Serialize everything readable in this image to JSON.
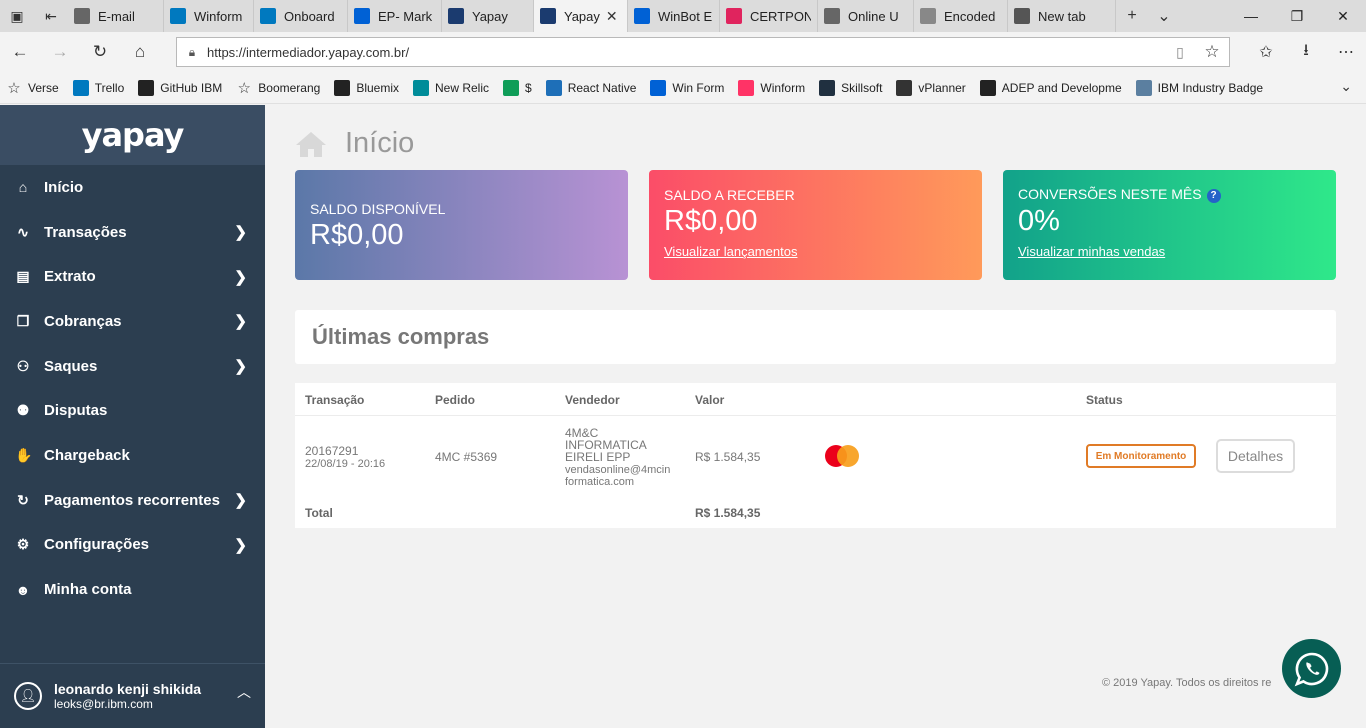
{
  "browser": {
    "tabs": [
      {
        "title": "E-mail",
        "icon": "page-icon",
        "color": "#666666",
        "active": false
      },
      {
        "title": "Winform",
        "icon": "trello-icon",
        "color": "#0079bf",
        "active": false
      },
      {
        "title": "Onboard",
        "icon": "trello-icon",
        "color": "#0079bf",
        "active": false
      },
      {
        "title": "EP- Mark",
        "icon": "box-icon",
        "color": "#0061d5",
        "active": false
      },
      {
        "title": "Yapay",
        "icon": "yapay-icon",
        "color": "#1b3b6f",
        "active": false
      },
      {
        "title": "Yapay",
        "icon": "yapay-icon",
        "color": "#1b3b6f",
        "active": true
      },
      {
        "title": "WinBot E",
        "icon": "box-icon",
        "color": "#0061d5",
        "active": false
      },
      {
        "title": "CERTPON",
        "icon": "certpon-icon",
        "color": "#e0245e",
        "active": false
      },
      {
        "title": "Online U",
        "icon": "page-icon",
        "color": "#666666",
        "active": false
      },
      {
        "title": "Encoded",
        "icon": "image-icon",
        "color": "#888888",
        "active": false
      },
      {
        "title": "New tab",
        "icon": "newtab-icon",
        "color": "#555555",
        "active": false
      }
    ],
    "url": "https://intermediador.yapay.com.br/",
    "favorites": [
      {
        "label": "Verse",
        "icon": "star-icon",
        "color": "#333333"
      },
      {
        "label": "Trello",
        "icon": "trello-icon",
        "color": "#0079bf"
      },
      {
        "label": "GitHub IBM",
        "icon": "github-icon",
        "color": "#222222"
      },
      {
        "label": "Boomerang",
        "icon": "star-icon",
        "color": "#333333"
      },
      {
        "label": "Bluemix",
        "icon": "bluemix-icon",
        "color": "#222222"
      },
      {
        "label": "New Relic",
        "icon": "newrelic-icon",
        "color": "#008c99"
      },
      {
        "label": "$",
        "icon": "sheets-icon",
        "color": "#0f9d58"
      },
      {
        "label": "React Native",
        "icon": "bing-icon",
        "color": "#1e6fb8"
      },
      {
        "label": "Win Form",
        "icon": "box-icon",
        "color": "#0061d5"
      },
      {
        "label": "Winform",
        "icon": "invision-icon",
        "color": "#ff3366"
      },
      {
        "label": "Skillsoft",
        "icon": "skillsoft-icon",
        "color": "#203040"
      },
      {
        "label": "vPlanner",
        "icon": "w3-icon",
        "color": "#333333"
      },
      {
        "label": "ADEP and Developme",
        "icon": "github-icon",
        "color": "#222222"
      },
      {
        "label": "IBM Industry Badge",
        "icon": "gear-icon",
        "color": "#5b7fa0"
      }
    ]
  },
  "sidebar": {
    "logo": "yapay",
    "items": [
      {
        "label": "Início",
        "icon": "home-icon",
        "glyph": "⌂",
        "has_submenu": false
      },
      {
        "label": "Transações",
        "icon": "chart-icon",
        "glyph": "∿",
        "has_submenu": true
      },
      {
        "label": "Extrato",
        "icon": "file-icon",
        "glyph": "▤",
        "has_submenu": true
      },
      {
        "label": "Cobranças",
        "icon": "copy-icon",
        "glyph": "❐",
        "has_submenu": true
      },
      {
        "label": "Saques",
        "icon": "cash-icon",
        "glyph": "⚇",
        "has_submenu": true
      },
      {
        "label": "Disputas",
        "icon": "users-icon",
        "glyph": "⚉",
        "has_submenu": false
      },
      {
        "label": "Chargeback",
        "icon": "thumbs-down-icon",
        "glyph": "✋",
        "has_submenu": false
      },
      {
        "label": "Pagamentos recorrentes",
        "icon": "refresh-icon",
        "glyph": "↻",
        "has_submenu": true
      },
      {
        "label": "Configurações",
        "icon": "gear-icon",
        "glyph": "⚙",
        "has_submenu": true
      },
      {
        "label": "Minha conta",
        "icon": "user-icon",
        "glyph": "☻",
        "has_submenu": false
      }
    ],
    "user": {
      "name": "leonardo kenji shikida",
      "email": "leoks@br.ibm.com"
    }
  },
  "main": {
    "title": "Início",
    "cards": {
      "available": {
        "label": "SALDO DISPONÍVEL",
        "value": "R$0,00"
      },
      "receivable": {
        "label": "SALDO A RECEBER",
        "value": "R$0,00",
        "link": "Visualizar lançamentos"
      },
      "conversions": {
        "label": "CONVERSÕES NESTE MÊS",
        "help": "?",
        "value": "0%",
        "link": "Visualizar minhas vendas"
      }
    },
    "last_purchases": {
      "title": "Últimas compras",
      "columns": [
        "Transação",
        "Pedido",
        "Vendedor",
        "Valor",
        "Status"
      ],
      "rows": [
        {
          "transaction": "20167291",
          "date": "22/08/19 - 20:16",
          "order": "4MC #5369",
          "seller_lines": [
            "4M&C",
            "INFORMATICA",
            "EIRELI EPP"
          ],
          "seller_email_lines": [
            "vendasonline@4mcin",
            "formatica.com"
          ],
          "value": "R$ 1.584,35",
          "payment_icon": "mastercard-icon",
          "status": "Em Monitoramento",
          "action": "Detalhes"
        }
      ],
      "total_label": "Total",
      "total_value": "R$ 1.584,35"
    },
    "footer": "© 2019 Yapay. Todos os direitos re"
  },
  "colors": {
    "sidebar_bg": "#2c3e50",
    "status_orange": "#e07b26",
    "whatsapp_green": "#075e54"
  }
}
